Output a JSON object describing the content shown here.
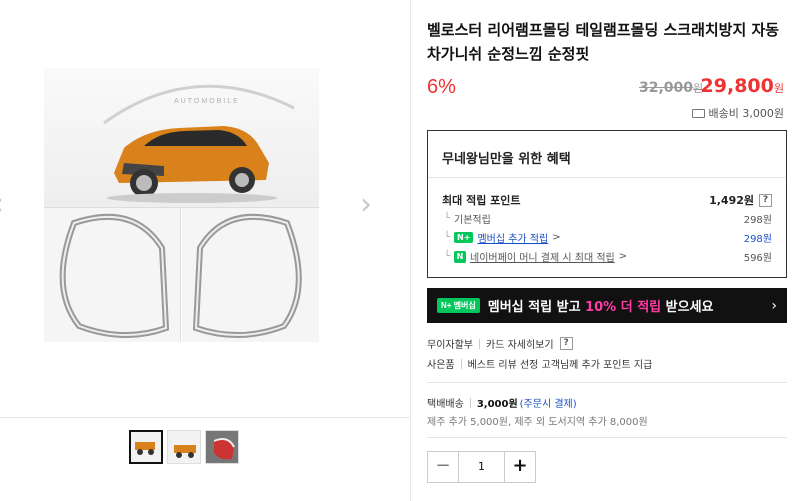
{
  "gallery": {
    "prev_arrow": "‹",
    "next_arrow": "›",
    "brand_mark": "AUTOMOBILE"
  },
  "product": {
    "title": "벨로스터 리어램프몰딩 테일램프몰딩 스크래치방지 자동차가니쉬 순정느낌 순정핏",
    "discount": "6%",
    "original_price": "32,000",
    "original_unit": "원",
    "sale_price": "29,800",
    "sale_unit": "원",
    "shipping_fee": "배송비 3,000원"
  },
  "benefits": {
    "title": "무네왕님만을 위한 혜택",
    "max_points_label": "최대 적립 포인트",
    "max_points_value": "1,492원",
    "help": "?",
    "rows": [
      {
        "label": "기본적립",
        "value": "298원"
      },
      {
        "badge": "N+",
        "label": "멤버십 추가 적립",
        "suffix": ">",
        "value": "298원"
      },
      {
        "badge": "N",
        "label": "네이버페이 머니 결제 시 최대 적립",
        "suffix": ">",
        "value": "596원"
      }
    ]
  },
  "promo": {
    "badge": "N+ 멤버십",
    "text_before": "멤버십 적립 받고 ",
    "text_highlight": "10% 더 적립",
    "text_after": " 받으세요",
    "arrow": "›"
  },
  "info": {
    "installment": "무이자할부",
    "card_detail": "카드 자세히보기",
    "gift_label": "사은품",
    "gift_text": "베스트 리뷰 선정 고객님께 추가 포인트 지급",
    "delivery_label": "택배배송",
    "delivery_fee": "3,000원",
    "delivery_note": "(주문시 결제)",
    "extra_fee": "제주 추가 5,000원, 제주 외 도서지역 추가 8,000원"
  },
  "quantity": {
    "minus": "−",
    "value": "1",
    "plus": "+"
  }
}
